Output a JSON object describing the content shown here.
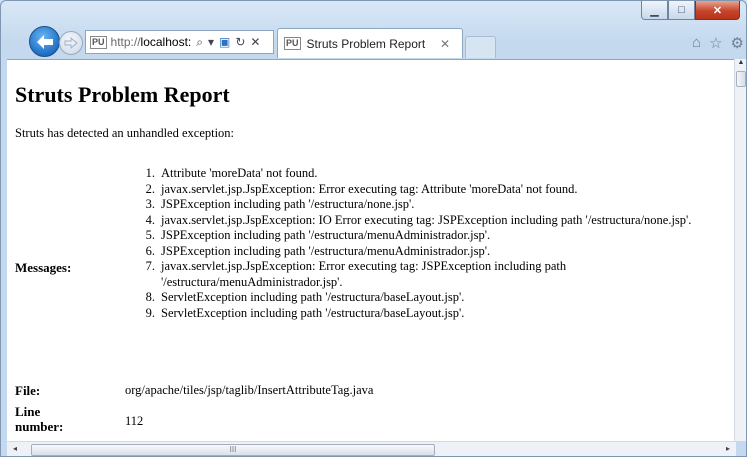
{
  "browser": {
    "address_url_proto": "http://",
    "address_url_host": "localhost:",
    "address_favicon": "PU",
    "tab_title": "Struts Problem Report",
    "tab_favicon": "PU",
    "icons": {
      "back": "back-arrow-icon",
      "forward": "forward-arrow-icon",
      "search": "search-icon",
      "dropdown": "dropdown-icon",
      "compat": "compatibility-view-icon",
      "refresh": "refresh-icon",
      "stop": "stop-icon",
      "home": "home-icon",
      "favorites": "star-icon",
      "tools": "gear-icon"
    }
  },
  "page": {
    "title": "Struts Problem Report",
    "intro": "Struts has detected an unhandled exception:",
    "messages_label": "Messages:",
    "messages": [
      {
        "num": "1.",
        "text": "Attribute 'moreData' not found."
      },
      {
        "num": "2.",
        "text": "javax.servlet.jsp.JspException: Error executing tag: Attribute 'moreData' not found."
      },
      {
        "num": "3.",
        "text": "JSPException including path '/estructura/none.jsp'."
      },
      {
        "num": "4.",
        "text": "javax.servlet.jsp.JspException: IO Error executing tag: JSPException including path '/estructura/none.jsp'."
      },
      {
        "num": "5.",
        "text": "JSPException including path '/estructura/menuAdministrador.jsp'."
      },
      {
        "num": "6.",
        "text": "JSPException including path '/estructura/menuAdministrador.jsp'."
      },
      {
        "num": "7.",
        "text": "javax.servlet.jsp.JspException: Error executing tag: JSPException including path '/estructura/menuAdministrador.jsp'."
      },
      {
        "num": "8.",
        "text": "ServletException including path '/estructura/baseLayout.jsp'."
      },
      {
        "num": "9.",
        "text": "ServletException including path '/estructura/baseLayout.jsp'."
      }
    ],
    "file_label": "File:",
    "file_value": "org/apache/tiles/jsp/taglib/InsertAttributeTag.java",
    "line_label": "Line number:",
    "line_value": "112"
  },
  "scrollbar": {
    "thumb_grip": "III"
  }
}
